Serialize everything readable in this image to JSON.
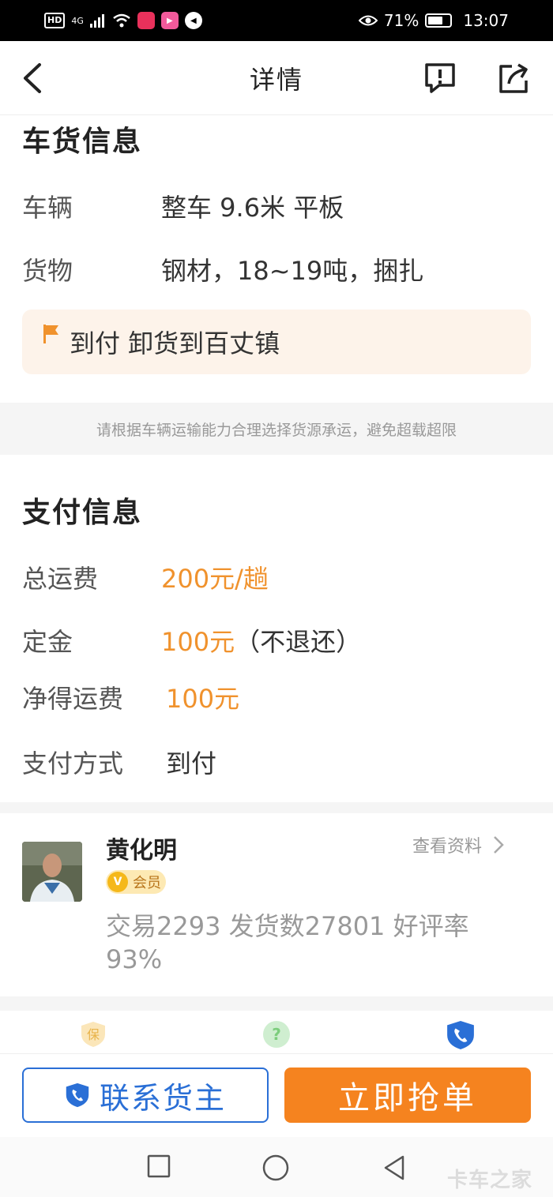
{
  "status_bar": {
    "hd": "HD",
    "network": "4G",
    "battery_percent": "71%",
    "battery_level": 0.71,
    "time": "13:07"
  },
  "header": {
    "title": "详情",
    "icons": [
      "back-arrow-icon",
      "report-icon",
      "share-icon"
    ]
  },
  "cargo": {
    "section_title": "车货信息",
    "rows": [
      {
        "label": "车辆",
        "value": "整车 9.6米 平板"
      },
      {
        "label": "货物",
        "value": "钢材，18~19吨，捆扎"
      }
    ],
    "notice": "到付 卸货到百丈镇"
  },
  "tip": "请根据车辆运输能力合理选择货源承运，避免超载超限",
  "payment": {
    "section_title": "支付信息",
    "total_fee_label": "总运费",
    "total_fee_value": "200元/趟",
    "deposit_label": "定金",
    "deposit_value": "100元",
    "deposit_note": "（不退还）",
    "net_fee_label": "净得运费",
    "net_fee_value": "100元",
    "method_label": "支付方式",
    "method_value": "到付"
  },
  "shipper": {
    "name": "黄化明",
    "badge_icon": "V",
    "badge_label": "会员",
    "view_profile": "查看资料",
    "stats": "交易2293 发货数27801 好评率93%"
  },
  "bottom_icons": {
    "guarantee": "保",
    "help": "?"
  },
  "actions": {
    "contact_label": "联系货主",
    "grab_label": "立即抢单"
  },
  "watermark": "卡车之家",
  "colors": {
    "accent_orange": "#f0922d",
    "primary_blue": "#2a6fd6",
    "grab_button": "#f5831f"
  }
}
